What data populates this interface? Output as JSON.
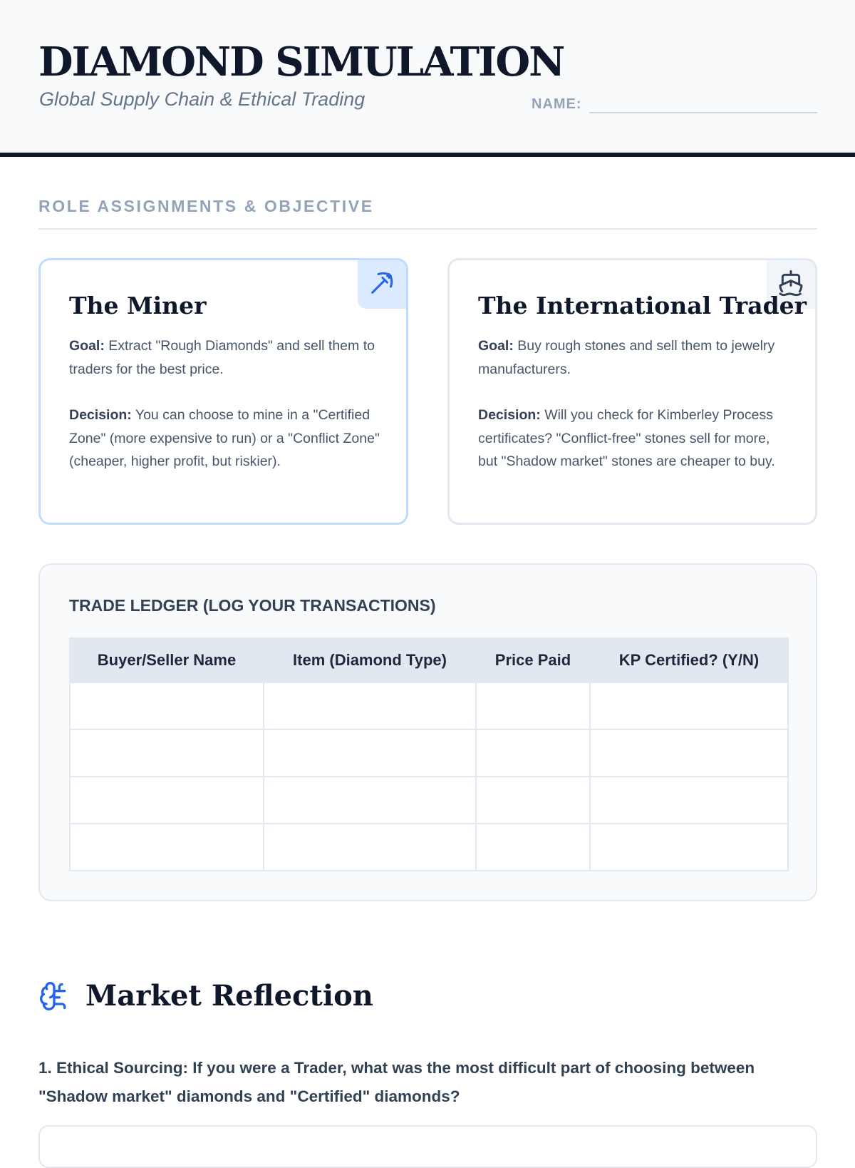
{
  "header": {
    "title": "DIAMOND SIMULATION",
    "subtitle": "Global Supply Chain & Ethical Trading",
    "name_label": "NAME:"
  },
  "roles": {
    "heading": "ROLE ASSIGNMENTS & OBJECTIVE",
    "cards": [
      {
        "title": "The Miner",
        "icon": "pickaxe-icon",
        "goal_label": "Goal:",
        "goal_text": " Extract \"Rough Diamonds\" and sell them to traders for the best price.",
        "decision_label": "Decision:",
        "decision_text": " You can choose to mine in a \"Certified Zone\" (more expensive to run) or a \"Conflict Zone\" (cheaper, higher profit, but riskier)."
      },
      {
        "title": "The International Trader",
        "icon": "ship-icon",
        "goal_label": "Goal:",
        "goal_text": " Buy rough stones and sell them to jewelry manufacturers.",
        "decision_label": "Decision:",
        "decision_text": " Will you check for Kimberley Process certificates? \"Conflict-free\" stones sell for more, but \"Shadow market\" stones are cheaper to buy."
      }
    ]
  },
  "ledger": {
    "title": "TRADE LEDGER (LOG YOUR TRANSACTIONS)",
    "columns": [
      "Buyer/Seller Name",
      "Item (Diamond Type)",
      "Price Paid",
      "KP Certified? (Y/N)"
    ],
    "rows": [
      [
        "",
        "",
        "",
        ""
      ],
      [
        "",
        "",
        "",
        ""
      ],
      [
        "",
        "",
        "",
        ""
      ],
      [
        "",
        "",
        "",
        ""
      ]
    ]
  },
  "reflection": {
    "icon": "brain-icon",
    "title": "Market Reflection",
    "questions": [
      "1. Ethical Sourcing: If you were a Trader, what was the most difficult part of choosing between \"Shadow market\" diamonds and \"Certified\" diamonds?"
    ]
  },
  "colors": {
    "accent": "#2563eb",
    "dark": "#0f172a",
    "muted": "#94a3b8"
  }
}
